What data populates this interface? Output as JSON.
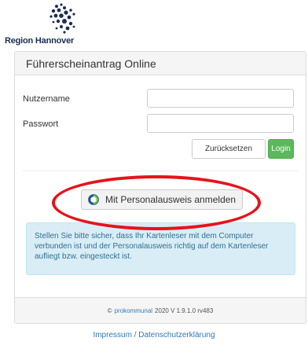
{
  "logo": {
    "text": "Region Hannover"
  },
  "panel": {
    "title": "Führerscheinantrag Online",
    "username_label": "Nutzername",
    "username_value": "",
    "password_label": "Passwort",
    "password_value": "",
    "reset_label": "Zurücksetzen",
    "login_label": "Login",
    "id_button_label": "Mit Personalausweis anmelden",
    "info_text": "Stellen Sie bitte sicher, dass Ihr Kartenleser mit dem Computer verbunden ist und der Personalausweis richtig auf dem Kartenleser aufliegt bzw. eingesteckt ist."
  },
  "footer": {
    "copyright": "©",
    "brand": "prokommunal",
    "version": "2020 V 1.9.1.0 rv483"
  },
  "links": {
    "impressum": "Impressum",
    "separator": "/",
    "datenschutz": "Datenschutzerklärung"
  },
  "colors": {
    "login_green": "#5cb85c",
    "info_background": "#d9edf7",
    "highlight_ellipse": "#e6131b",
    "link_blue": "#337ab7"
  }
}
